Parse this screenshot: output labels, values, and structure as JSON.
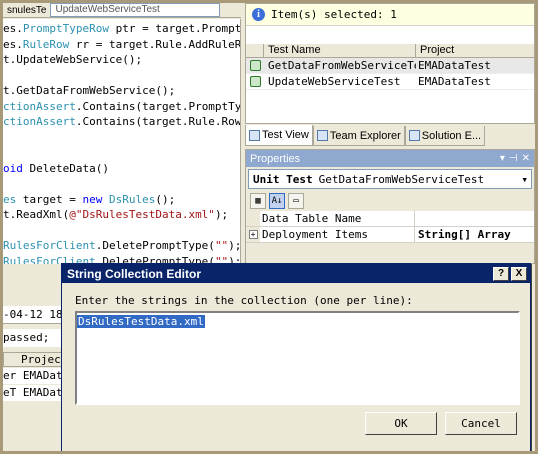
{
  "editor": {
    "tabs": [
      "snulesTe",
      "UpdateWebServiceTest"
    ],
    "lines": [
      [
        {
          "t": "es.",
          "c": ""
        },
        {
          "t": "PromptTypeRow",
          "c": "ty"
        },
        {
          "t": " ptr = target.Prompt",
          "c": ""
        }
      ],
      [
        {
          "t": "es.",
          "c": ""
        },
        {
          "t": "RuleRow",
          "c": "ty"
        },
        {
          "t": " rr = target.Rule.AddRuleR",
          "c": ""
        }
      ],
      [
        {
          "t": "t.UpdateWebService();",
          "c": ""
        }
      ],
      [
        {
          "t": "",
          "c": ""
        }
      ],
      [
        {
          "t": "t.GetDataFromWebService();",
          "c": ""
        }
      ],
      [
        {
          "t": "ctionAssert",
          "c": "ty"
        },
        {
          "t": ".Contains(target.PromptTyp",
          "c": ""
        }
      ],
      [
        {
          "t": "ctionAssert",
          "c": "ty"
        },
        {
          "t": ".Contains(target.Rule.Rows",
          "c": ""
        }
      ],
      [
        {
          "t": "",
          "c": ""
        }
      ],
      [
        {
          "t": "",
          "c": ""
        }
      ],
      [
        {
          "t": "oid",
          "c": "kw"
        },
        {
          "t": " DeleteData()",
          "c": ""
        }
      ],
      [
        {
          "t": "",
          "c": ""
        }
      ],
      [
        {
          "t": "es",
          "c": "ty"
        },
        {
          "t": " target = ",
          "c": ""
        },
        {
          "t": "new",
          "c": "kw"
        },
        {
          "t": " ",
          "c": ""
        },
        {
          "t": "DsRules",
          "c": "ty"
        },
        {
          "t": "();",
          "c": ""
        }
      ],
      [
        {
          "t": "t.ReadXml(",
          "c": ""
        },
        {
          "t": "@\"DsRulesTestData.xml\"",
          "c": "st"
        },
        {
          "t": ");",
          "c": ""
        }
      ],
      [
        {
          "t": "",
          "c": ""
        }
      ],
      [
        {
          "t": "RulesForClient",
          "c": "ty"
        },
        {
          "t": ".DeletePromptType(",
          "c": ""
        },
        {
          "t": "\"\"",
          "c": "st"
        },
        {
          "t": ");",
          "c": ""
        }
      ],
      [
        {
          "t": "RulesForClient",
          "c": "ty"
        },
        {
          "t": ".DeletePromptType(",
          "c": ""
        },
        {
          "t": "\"\"",
          "c": "st"
        },
        {
          "t": ");",
          "c": ""
        }
      ]
    ]
  },
  "test_view": {
    "info": "Item(s) selected: 1",
    "columns": [
      "Test Name",
      "Project"
    ],
    "rows": [
      {
        "name": "GetDataFromWebServiceTest",
        "project": "EMADataTest"
      },
      {
        "name": "UpdateWebServiceTest",
        "project": "EMADataTest"
      }
    ],
    "tabs": [
      "Test View",
      "Team Explorer",
      "Solution E..."
    ]
  },
  "properties": {
    "title": "Properties",
    "object_type": "Unit Test",
    "object_name": "GetDataFromWebServiceTest",
    "rows": [
      {
        "name": "Data Table Name",
        "value": ""
      },
      {
        "name": "Deployment Items",
        "value": "String[] Array"
      }
    ]
  },
  "bottom_left": {
    "date": "-04-12 18",
    "passed": "passed;",
    "column": "Projec",
    "rows": [
      "er EMADat",
      "eT EMADat"
    ]
  },
  "dialog": {
    "title": "String Collection Editor",
    "label": "Enter the strings in the collection (one per line):",
    "text_value": "DsRulesTestData.xml",
    "ok_label": "OK",
    "cancel_label": "Cancel",
    "help_glyph": "?",
    "close_glyph": "X"
  }
}
